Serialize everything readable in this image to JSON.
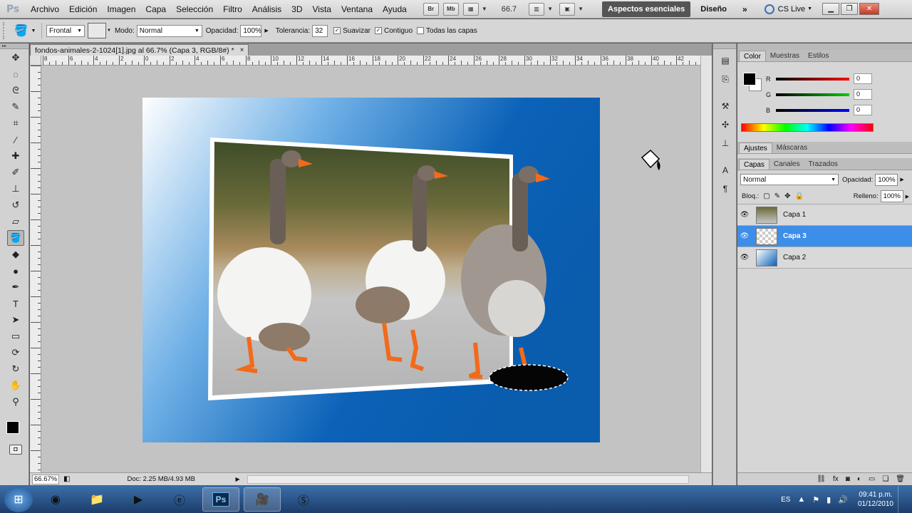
{
  "menubar": {
    "app_icon": "Ps",
    "menus": [
      "Archivo",
      "Edición",
      "Imagen",
      "Capa",
      "Selección",
      "Filtro",
      "Análisis",
      "3D",
      "Vista",
      "Ventana",
      "Ayuda"
    ],
    "bridge_label": "Br",
    "minibridge_label": "Mb",
    "zoom_level": "66.7",
    "workspace_active": "Aspectos esenciales",
    "workspace_other": "Diseño",
    "more": "»",
    "cslive": "CS Live"
  },
  "options": {
    "fill_source": "Frontal",
    "mode_label": "Modo:",
    "mode_value": "Normal",
    "opacity_label": "Opacidad:",
    "opacity_value": "100%",
    "tolerance_label": "Tolerancia:",
    "tolerance_value": "32",
    "antialias_label": "Suavizar",
    "contiguous_label": "Contiguo",
    "all_layers_label": "Todas las capas"
  },
  "document": {
    "tab_title": "fondos-animales-2-1024[1].jpg al 66.7% (Capa 3, RGB/8#) *",
    "tab_close": "×",
    "ruler_labels": [
      "8",
      "6",
      "4",
      "2",
      "0",
      "2",
      "4",
      "6",
      "8",
      "10",
      "12",
      "14",
      "16",
      "18",
      "20",
      "22",
      "24",
      "26",
      "28",
      "30",
      "32",
      "34",
      "36",
      "38",
      "40",
      "42"
    ],
    "zoom_status": "66.67%",
    "doc_info": "Doc: 2.25 MB/4.93 MB"
  },
  "color_panel": {
    "tabs": [
      "Color",
      "Muestras",
      "Estilos"
    ],
    "r_label": "R",
    "g_label": "G",
    "b_label": "B",
    "r_value": "0",
    "g_value": "0",
    "b_value": "0"
  },
  "adjust_panel": {
    "tabs": [
      "Ajustes",
      "Máscaras"
    ]
  },
  "layers_panel": {
    "tabs": [
      "Capas",
      "Canales",
      "Trazados"
    ],
    "blend_mode": "Normal",
    "opacity_label": "Opacidad:",
    "opacity_value": "100%",
    "lock_label": "Bloq.:",
    "fill_label": "Relleno:",
    "fill_value": "100%",
    "layers": [
      {
        "name": "Capa 1"
      },
      {
        "name": "Capa 3"
      },
      {
        "name": "Capa 2"
      }
    ]
  },
  "taskbar": {
    "language": "ES",
    "time": "09:41 p.m.",
    "date": "01/12/2010",
    "ps_label": "Ps"
  },
  "colors": {
    "accent_selected": "#3d8ee8",
    "workspace_active_bg": "#555555",
    "canvas_blue": "#0b62b8"
  }
}
